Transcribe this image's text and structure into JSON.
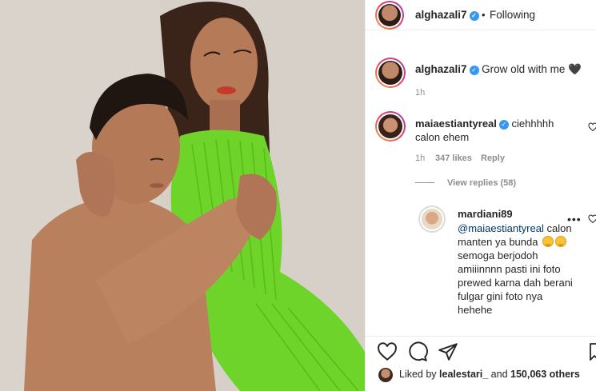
{
  "post": {
    "author": "alghazali7",
    "follow_state": "Following",
    "separator": "•",
    "caption": "Grow old with me 🖤",
    "caption_time": "1h"
  },
  "comment": {
    "user": "maiaestiantyreal",
    "text": "ciehhhhh calon ehem",
    "time": "1h",
    "likes": "347 likes",
    "reply_label": "Reply",
    "view_replies": "View replies (58)"
  },
  "reply": {
    "user": "mardiani89",
    "mention": "@maiaestiantyreal",
    "text_after_mention": " calon manten ya bunda",
    "text_rest": "semoga berjodoh amiiinnnn pasti ini foto prewed karna dah berani fulgar gini foto nya hehehe",
    "more_label": "•••"
  },
  "likes_bar": {
    "prefix": "Liked by ",
    "first_liker": "lealestari_",
    "middle": " and ",
    "count": "150,063 others"
  },
  "icons": [
    "verified-badge-icon",
    "heart-icon",
    "comment-icon",
    "share-icon",
    "bookmark-icon",
    "more-options-icon",
    "emoji-icon"
  ],
  "colors": {
    "verified": "#3897f0",
    "meta": "#8e8e8e",
    "mention": "#00376b",
    "dress": "#6fd42a",
    "ring_start": "#f9a13b",
    "ring_end": "#a43ab5"
  }
}
